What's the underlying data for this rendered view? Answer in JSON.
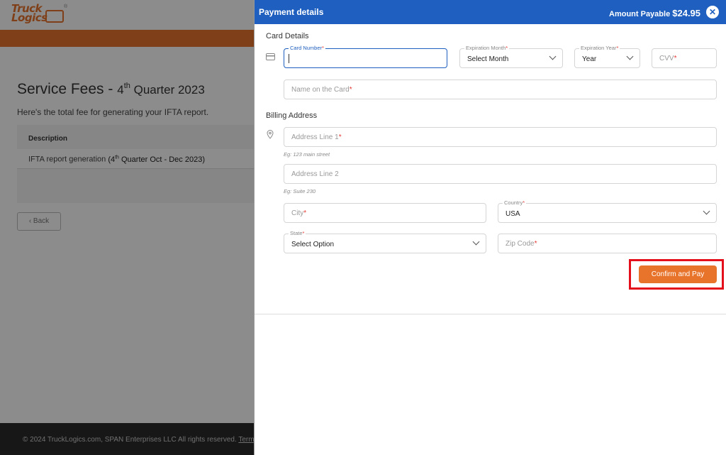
{
  "background": {
    "logo_text": "Truck Logics",
    "title_main": "Service Fees - ",
    "title_q": "4",
    "title_sup": "th",
    "title_rest": " Quarter 2023",
    "subtitle": "Here's the total fee for generating your IFTA report.",
    "table_header": "Description",
    "row_text": "IFTA report generation ",
    "row_q": "(4",
    "row_sup": "th",
    "row_rest": " Quarter Oct - Dec 2023)",
    "back_label": "‹ Back",
    "footer_text": "© 2024 TruckLogics.com, SPAN Enterprises LLC All rights reserved. ",
    "footer_terms": "Term"
  },
  "panel": {
    "title": "Payment details",
    "amount_label": "Amount Payable ",
    "amount_value": "$24.95",
    "close_glyph": "✕"
  },
  "card": {
    "section_title": "Card Details",
    "card_number_label": "Card Number",
    "exp_month_label": "Expiration Month",
    "exp_month_value": "Select Month",
    "exp_year_label": "Expiration Year",
    "exp_year_value": "Year",
    "cvv_placeholder": "CVV",
    "name_placeholder": "Name on the Card"
  },
  "billing": {
    "section_title": "Billing Address",
    "address1_placeholder": "Address Line 1",
    "address1_hint": "Eg: 123 main street",
    "address2_placeholder": "Address Line 2",
    "address2_hint": "Eg: Suite 230",
    "city_placeholder": "City",
    "country_label": "Country",
    "country_value": "USA",
    "state_label": "State",
    "state_value": "Select Option",
    "zip_placeholder": "Zip Code",
    "required_mark": "*"
  },
  "actions": {
    "confirm_label": "Confirm and Pay"
  }
}
